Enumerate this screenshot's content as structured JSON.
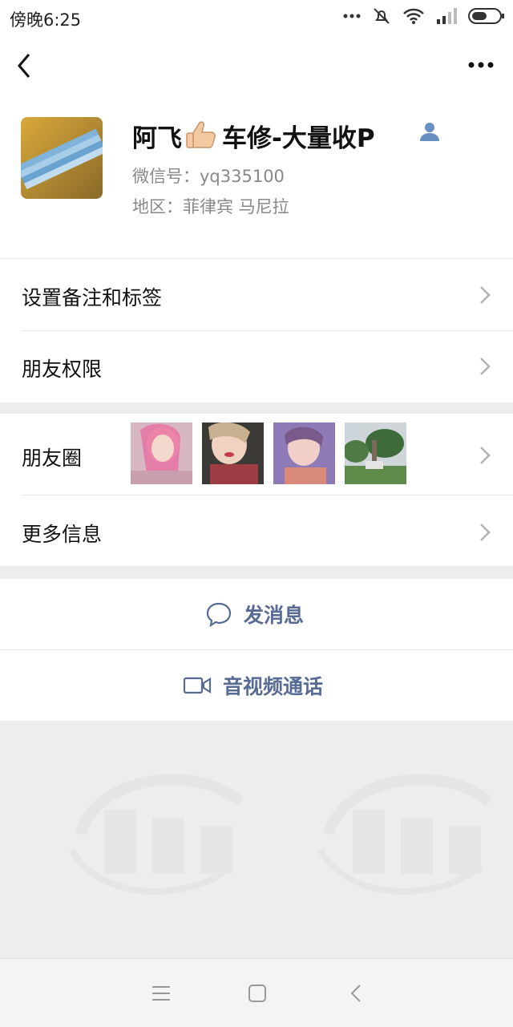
{
  "status_bar": {
    "time": "傍晚6:25",
    "icons": [
      "more-dots-icon",
      "mute-icon",
      "wifi-icon",
      "signal-icon",
      "battery-icon"
    ]
  },
  "top_bar": {
    "back_icon": "chevron-left-icon",
    "more_icon": "more-horizontal-icon"
  },
  "profile": {
    "name": "阿飞",
    "name_suffix": "车修-大量收P",
    "emoji": "thumbs-up",
    "wechat_id": "微信号：yq335100",
    "region": "地区：菲律宾  马尼拉"
  },
  "menu": {
    "remark_tags": "设置备注和标签",
    "permissions": "朋友权限",
    "moments": "朋友圈",
    "more_info": "更多信息"
  },
  "actions": {
    "send_message": "发消息",
    "video_call": "音视频通话"
  },
  "colors": {
    "link": "#576b95",
    "background": "#ededed",
    "panel": "#ffffff"
  }
}
